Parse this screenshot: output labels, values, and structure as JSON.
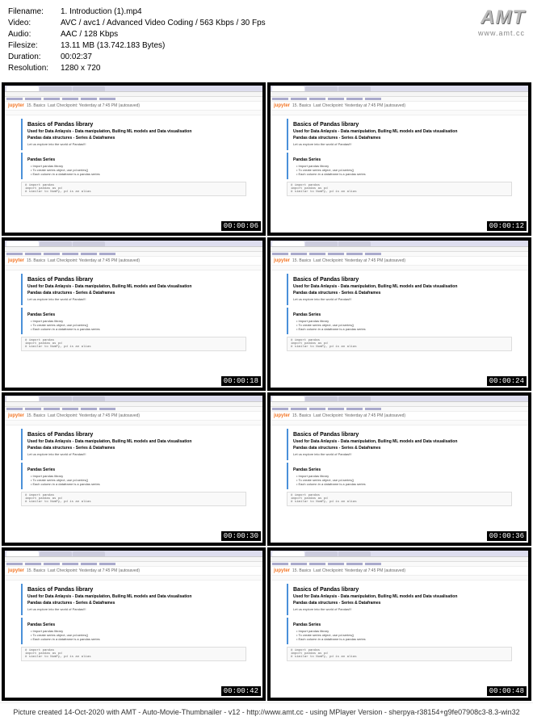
{
  "meta": {
    "filename_label": "Filename:",
    "filename": "1. Introduction (1).mp4",
    "video_label": "Video:",
    "video": "AVC / avc1 / Advanced Video Coding / 563 Kbps / 30 Fps",
    "audio_label": "Audio:",
    "audio": "AAC / 128 Kbps",
    "filesize_label": "Filesize:",
    "filesize": "13.11 MB (13.742.183 Bytes)",
    "duration_label": "Duration:",
    "duration": "00:02:37",
    "resolution_label": "Resolution:",
    "resolution": "1280 x 720"
  },
  "logo": {
    "text": "AMT",
    "url": "www.amt.cc"
  },
  "notebook": {
    "app": "jupyter",
    "name": "15. Basics",
    "checkpoint": "Last Checkpoint: Yesterday at 7:45 PM  (autosaved)",
    "heading": "Basics of Pandas library",
    "line1": "Used for Data Anlaysis - Data manipulation, Builing ML models and Data visualisation",
    "line2": "Pandas data structures - Series & Dataframes",
    "line3": "Let us explore into the world of Pandas!!!",
    "section": "Pandas Series",
    "b1": "• Import pandas library",
    "b2": "• To create series object, use pd.series()",
    "b3": "• Each column in a dataframe is a pandas series",
    "code1": "# import pandas",
    "code2": "import pandas as pd",
    "code3": "# similar to NumPy, pd is an alias"
  },
  "timestamps": [
    "00:00:06",
    "00:00:12",
    "00:00:18",
    "00:00:24",
    "00:00:30",
    "00:00:36",
    "00:00:42",
    "00:00:48"
  ],
  "footer": "Picture created 14-Oct-2020 with AMT - Auto-Movie-Thumbnailer - v12 - http://www.amt.cc - using MPlayer Version - sherpya-r38154+g9fe07908c3-8.3-win32"
}
